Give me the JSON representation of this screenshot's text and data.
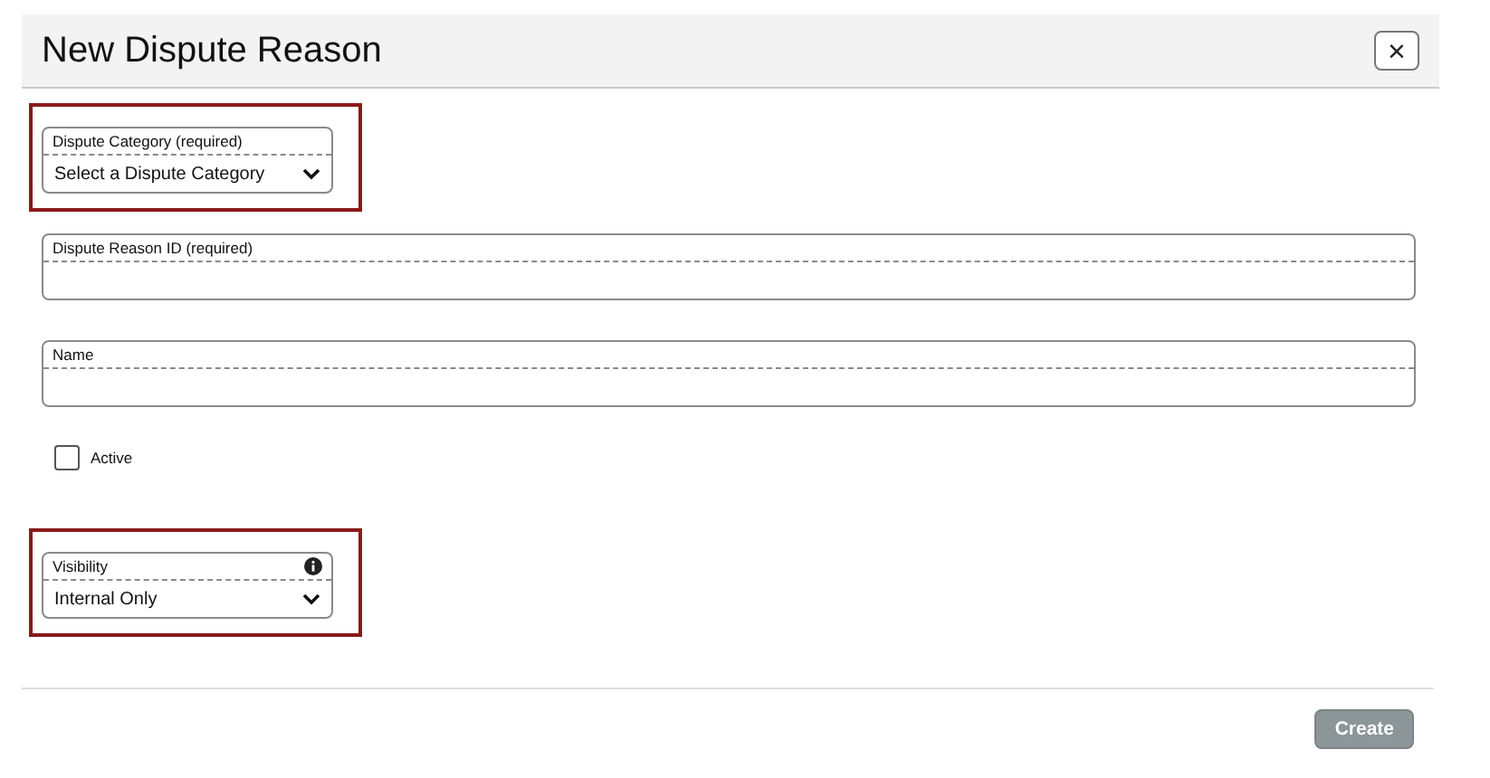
{
  "dialog": {
    "title": "New Dispute Reason",
    "close_label": "×"
  },
  "fields": [
    {
      "kind": "select",
      "label": "Dispute Category (required)",
      "value": "Select a Dispute Category",
      "highlighted": true,
      "info": false
    },
    {
      "kind": "text",
      "label": "Dispute Reason ID (required)",
      "highlighted": false,
      "info": false
    },
    {
      "kind": "text",
      "label": "Name",
      "highlighted": false,
      "info": false
    },
    {
      "kind": "checkbox",
      "label": "Active",
      "checked": false
    },
    {
      "kind": "select",
      "label": "Visibility",
      "value": "Internal Only",
      "highlighted": true,
      "info": true
    }
  ],
  "buttons": [
    {
      "label": "Create",
      "disabled": true
    }
  ]
}
